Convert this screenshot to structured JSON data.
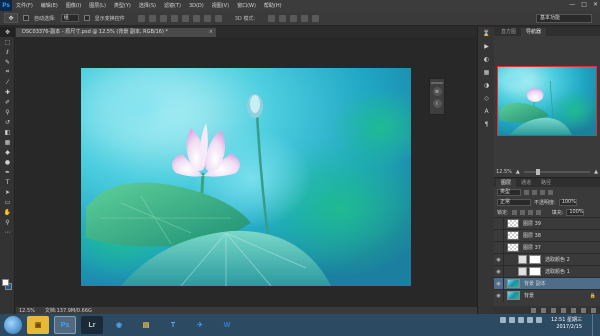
{
  "app": {
    "logo": "Ps"
  },
  "menu": [
    "文件(F)",
    "编辑(E)",
    "图像(I)",
    "图层(L)",
    "类型(Y)",
    "选择(S)",
    "滤镜(T)",
    "3D(D)",
    "视图(V)",
    "窗口(W)",
    "帮助(H)"
  ],
  "window_controls": [
    "—",
    "□",
    "✕"
  ],
  "options": {
    "auto_select_label": "自动选择:",
    "auto_select_value": "组",
    "show_transform_label": "显示变换控件",
    "mode_3d_label": "3D 模式:",
    "workspace": "基本功能"
  },
  "document": {
    "tab_title": "DSC03376-副本 - 原尺寸.psd @ 12.5% (背景 副本, RGB/16) *",
    "close_glyph": "×"
  },
  "status": {
    "zoom": "12.5%",
    "doc_size": "文档:137.9M/0.66G"
  },
  "navigator": {
    "tabs": [
      "直方图",
      "导航器"
    ],
    "active_tab": 1,
    "zoom": "12.5%"
  },
  "layers": {
    "tabs": [
      "图层",
      "通道",
      "路径"
    ],
    "active_tab": 0,
    "filter_label": "类型",
    "blend_mode": "正常",
    "opacity_label": "不透明度:",
    "opacity_value": "100%",
    "lock_label": "锁定:",
    "fill_label": "填充:",
    "fill_value": "100%",
    "items": [
      {
        "name": "图层 39",
        "kind": "pixel",
        "visible": false,
        "selected": false
      },
      {
        "name": "图层 38",
        "kind": "pixel",
        "visible": false,
        "selected": false
      },
      {
        "name": "图层 37",
        "kind": "pixel",
        "visible": false,
        "selected": false
      },
      {
        "name": "选取颜色 2",
        "kind": "adjustment",
        "visible": true,
        "selected": false
      },
      {
        "name": "选取颜色 1",
        "kind": "adjustment",
        "visible": true,
        "selected": false
      },
      {
        "name": "背景 副本",
        "kind": "image",
        "visible": true,
        "selected": true
      },
      {
        "name": "背景",
        "kind": "image",
        "visible": true,
        "selected": false
      }
    ]
  },
  "taskbar": {
    "time": "12:51 星期三",
    "date": "2017/2/15"
  },
  "colors": {
    "foreground": "#ffffff",
    "background": "#1f5a8a",
    "selection": "#4d6d8a"
  }
}
